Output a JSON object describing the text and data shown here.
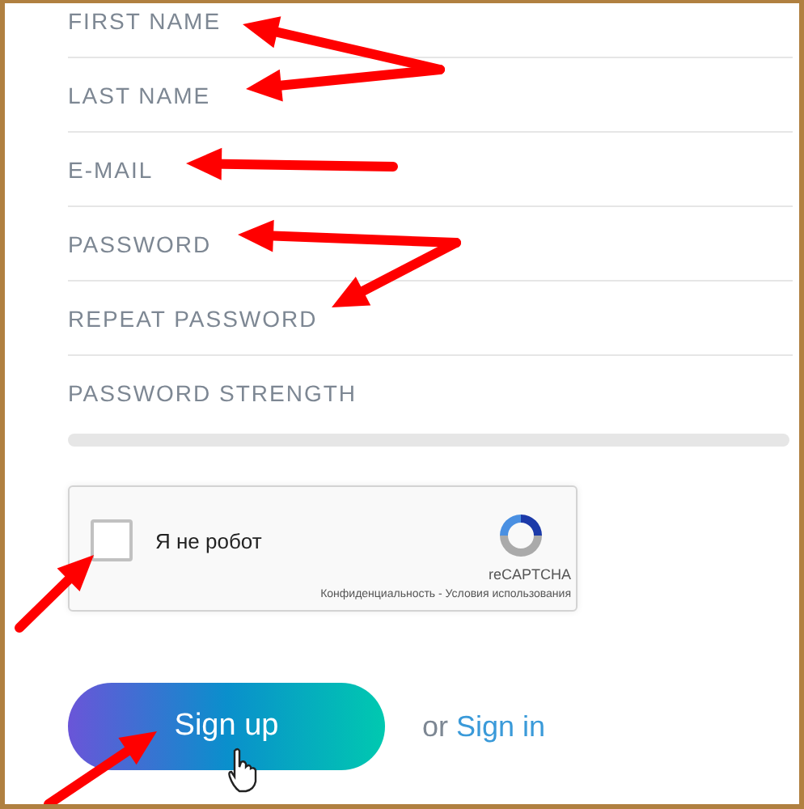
{
  "fields": [
    {
      "placeholder": "FIRST NAME"
    },
    {
      "placeholder": "LAST NAME"
    },
    {
      "placeholder": "E-MAIL"
    },
    {
      "placeholder": "PASSWORD"
    },
    {
      "placeholder": "REPEAT PASSWORD"
    }
  ],
  "strength": {
    "label": "PASSWORD STRENGTH",
    "level": 0
  },
  "captcha": {
    "checked": false,
    "label": "Я не робот",
    "brand": "reCAPTCHA",
    "links": "Конфиденциальность - Условия использования"
  },
  "signup": {
    "button": "Sign up",
    "or": "or",
    "link": "Sign in"
  }
}
